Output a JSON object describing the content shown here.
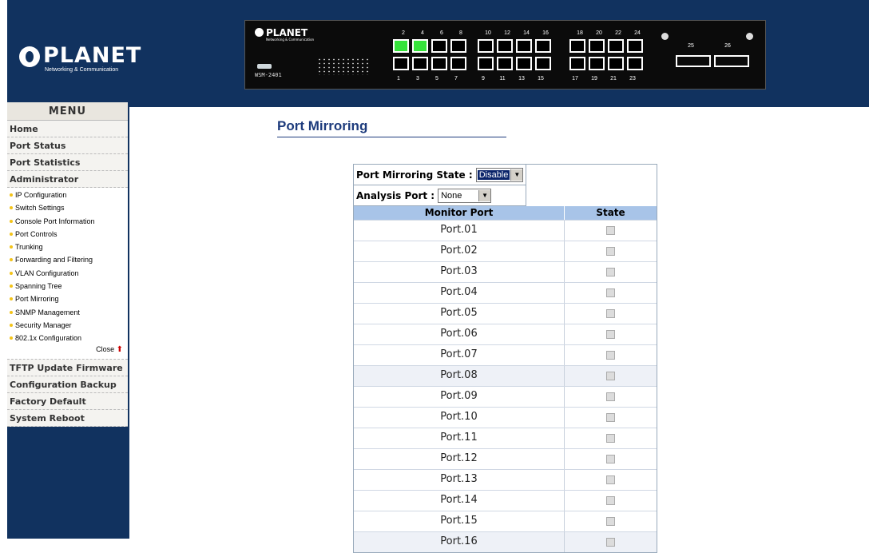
{
  "brand": {
    "name": "PLANET",
    "tagline": "Networking & Communication"
  },
  "switch_panel": {
    "model": "WSM-2401",
    "top_ports": [
      "2",
      "4",
      "6",
      "8",
      "10",
      "12",
      "14",
      "16",
      "18",
      "20",
      "22",
      "24"
    ],
    "bottom_ports": [
      "1",
      "3",
      "5",
      "7",
      "9",
      "11",
      "13",
      "15",
      "17",
      "19",
      "21",
      "23"
    ],
    "active_ports": [
      "2",
      "4"
    ],
    "uplink_ports": [
      "25",
      "26"
    ],
    "active_color": "#35e33a"
  },
  "menu": {
    "title": "MENU",
    "items_top": [
      "Home",
      "Port Status",
      "Port Statistics",
      "Administrator"
    ],
    "sub_items": [
      "IP Configuration",
      "Switch Settings",
      "Console Port Information",
      "Port Controls",
      "Trunking",
      "Forwarding and Filtering",
      "VLAN Configuration",
      "Spanning Tree",
      "Port Mirroring",
      "SNMP Management",
      "Security Manager",
      "802.1x Configuration"
    ],
    "close_label": "Close",
    "items_bottom": [
      "TFTP Update Firmware",
      "Configuration Backup",
      "Factory Default",
      "System Reboot"
    ]
  },
  "page": {
    "title": "Port Mirroring"
  },
  "mirroring": {
    "state_label": "Port Mirroring State :",
    "state_value": "Disable",
    "analysis_label": "Analysis Port :",
    "analysis_value": "None",
    "col_monitor": "Monitor Port",
    "col_state": "State",
    "ports": [
      "Port.01",
      "Port.02",
      "Port.03",
      "Port.04",
      "Port.05",
      "Port.06",
      "Port.07",
      "Port.08",
      "Port.09",
      "Port.10",
      "Port.11",
      "Port.12",
      "Port.13",
      "Port.14",
      "Port.15",
      "Port.16"
    ]
  },
  "colors": {
    "header_bg": "#11325f",
    "title": "#1d3b7c",
    "table_header": "#a8c4e8"
  }
}
